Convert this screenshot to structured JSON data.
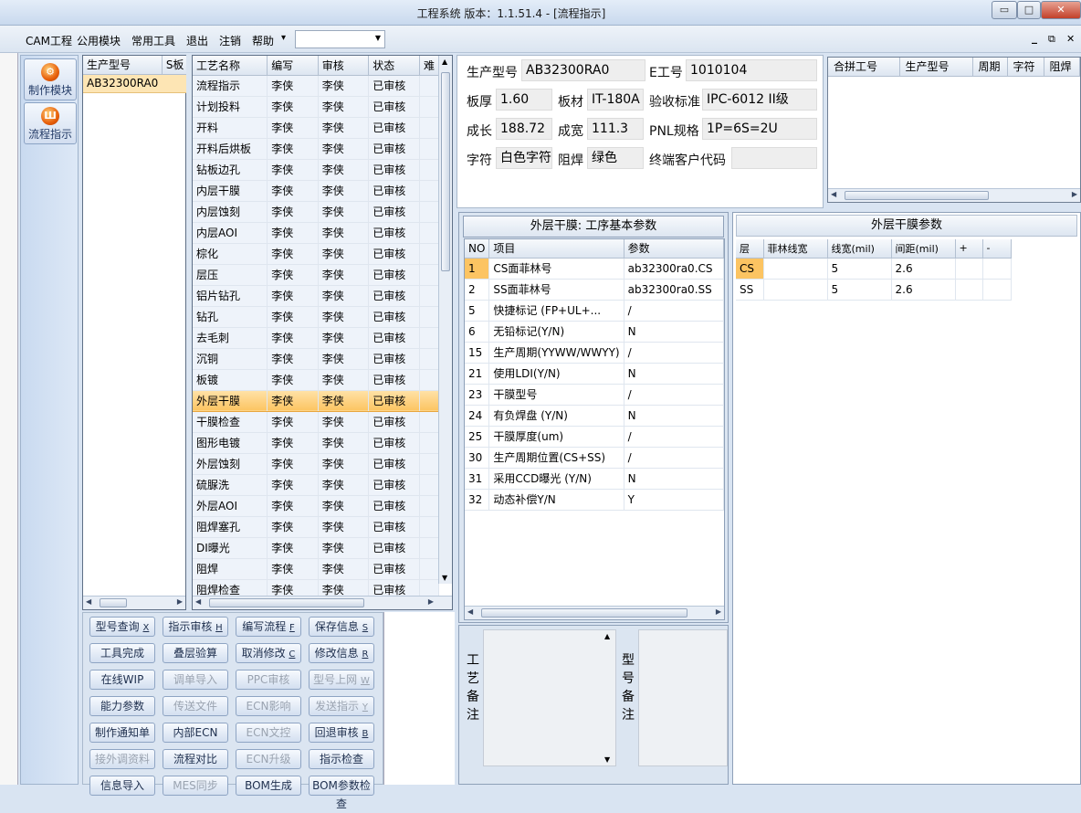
{
  "window": {
    "title": "工程系统   版本：1.1.51.4 - [流程指示]",
    "min_glyph": "▭",
    "max_glyph": "□",
    "close_glyph": "✕"
  },
  "menu": {
    "items": [
      "CAM工程",
      "公用模块",
      "常用工具",
      "退出",
      "注销",
      "帮助"
    ],
    "dropdown_glyph": "▾",
    "combo_value": "",
    "mdi_min": "_",
    "mdi_restore": "⧉",
    "mdi_close": "✕"
  },
  "nav": {
    "items": [
      {
        "label": "制作模块",
        "icon": "gear-icon",
        "glyph": "⚙"
      },
      {
        "label": "流程指示",
        "icon": "flow-icon",
        "glyph": "Ш"
      }
    ]
  },
  "model_list": {
    "headers": [
      "生产型号",
      "S板"
    ],
    "rows": [
      [
        "AB32300RA0",
        ""
      ]
    ]
  },
  "process_table": {
    "headers": [
      "工艺名称",
      "编写",
      "审核",
      "状态",
      "难"
    ],
    "selected_index": 15,
    "rows": [
      [
        "流程指示",
        "李侠",
        "李侠",
        "已审核"
      ],
      [
        "计划投料",
        "李侠",
        "李侠",
        "已审核"
      ],
      [
        "开料",
        "李侠",
        "李侠",
        "已审核"
      ],
      [
        "开料后烘板",
        "李侠",
        "李侠",
        "已审核"
      ],
      [
        "钻板边孔",
        "李侠",
        "李侠",
        "已审核"
      ],
      [
        "内层干膜",
        "李侠",
        "李侠",
        "已审核"
      ],
      [
        "内层蚀刻",
        "李侠",
        "李侠",
        "已审核"
      ],
      [
        "内层AOI",
        "李侠",
        "李侠",
        "已审核"
      ],
      [
        "棕化",
        "李侠",
        "李侠",
        "已审核"
      ],
      [
        "层压",
        "李侠",
        "李侠",
        "已审核"
      ],
      [
        "铝片钻孔",
        "李侠",
        "李侠",
        "已审核"
      ],
      [
        "钻孔",
        "李侠",
        "李侠",
        "已审核"
      ],
      [
        "去毛刺",
        "李侠",
        "李侠",
        "已审核"
      ],
      [
        "沉铜",
        "李侠",
        "李侠",
        "已审核"
      ],
      [
        "板镀",
        "李侠",
        "李侠",
        "已审核"
      ],
      [
        "外层干膜",
        "李侠",
        "李侠",
        "已审核"
      ],
      [
        "干膜检查",
        "李侠",
        "李侠",
        "已审核"
      ],
      [
        "图形电镀",
        "李侠",
        "李侠",
        "已审核"
      ],
      [
        "外层蚀刻",
        "李侠",
        "李侠",
        "已审核"
      ],
      [
        "硫脲洗",
        "李侠",
        "李侠",
        "已审核"
      ],
      [
        "外层AOI",
        "李侠",
        "李侠",
        "已审核"
      ],
      [
        "阻焊塞孔",
        "李侠",
        "李侠",
        "已审核"
      ],
      [
        "DI曝光",
        "李侠",
        "李侠",
        "已审核"
      ],
      [
        "阻焊",
        "李侠",
        "李侠",
        "已审核"
      ],
      [
        "阻焊检查",
        "李侠",
        "李侠",
        "已审核"
      ]
    ]
  },
  "actions": [
    {
      "label": "型号查询",
      "key": "X",
      "enabled": true
    },
    {
      "label": "指示审核",
      "key": "H",
      "enabled": true
    },
    {
      "label": "编写流程",
      "key": "F",
      "enabled": true
    },
    {
      "label": "保存信息",
      "key": "S",
      "enabled": true
    },
    {
      "label": "工具完成",
      "key": "",
      "enabled": true
    },
    {
      "label": "叠层验算",
      "key": "",
      "enabled": true
    },
    {
      "label": "取消修改",
      "key": "C",
      "enabled": true
    },
    {
      "label": "修改信息",
      "key": "R",
      "enabled": true
    },
    {
      "label": "在线WIP",
      "key": "",
      "enabled": true
    },
    {
      "label": "调单导入",
      "key": "",
      "enabled": false
    },
    {
      "label": "PPC审核",
      "key": "",
      "enabled": false
    },
    {
      "label": "型号上网",
      "key": "W",
      "enabled": false
    },
    {
      "label": "能力参数",
      "key": "",
      "enabled": true
    },
    {
      "label": "传送文件",
      "key": "",
      "enabled": false
    },
    {
      "label": "ECN影响",
      "key": "",
      "enabled": false
    },
    {
      "label": "发送指示",
      "key": "Y",
      "enabled": false
    },
    {
      "label": "制作通知单",
      "key": "",
      "enabled": true
    },
    {
      "label": "内部ECN",
      "key": "",
      "enabled": true
    },
    {
      "label": "ECN文控",
      "key": "",
      "enabled": false
    },
    {
      "label": "回退审核",
      "key": "B",
      "enabled": true
    },
    {
      "label": "接外调资料",
      "key": "",
      "enabled": false
    },
    {
      "label": "流程对比",
      "key": "",
      "enabled": true
    },
    {
      "label": "ECN升级",
      "key": "",
      "enabled": false
    },
    {
      "label": "指示检查",
      "key": "",
      "enabled": true
    },
    {
      "label": "信息导入",
      "key": "",
      "enabled": true
    },
    {
      "label": "MES同步",
      "key": "",
      "enabled": false
    },
    {
      "label": "BOM生成",
      "key": "",
      "enabled": true
    },
    {
      "label": "BOM参数检查",
      "key": "",
      "enabled": true
    }
  ],
  "info": {
    "model_label": "生产型号",
    "model": "AB32300RA0",
    "eno_label": "E工号",
    "eno": "1010104",
    "thick_label": "板厚",
    "thick": "1.60",
    "material_label": "板材",
    "material": "IT-180A",
    "std_label": "验收标准",
    "std": "IPC-6012 II级",
    "length_label": "成长",
    "length": "188.72",
    "width_label": "成宽",
    "width": "111.3",
    "pnl_label": "PNL规格",
    "pnl": "1P=6S=2U",
    "char_label": "字符",
    "char": "白色字符",
    "mask_label": "阻焊",
    "mask": "绿色",
    "cust_label": "终端客户代码",
    "cust": ""
  },
  "merge_table": {
    "headers": [
      "合拼工号",
      "生产型号",
      "周期",
      "字符",
      "阻焊"
    ]
  },
  "process_params": {
    "title": "外层干膜: 工序基本参数",
    "headers": [
      "NO",
      "项目",
      "参数"
    ],
    "rows": [
      [
        "1",
        "CS面菲林号",
        "ab32300ra0.CS"
      ],
      [
        "2",
        "SS面菲林号",
        "ab32300ra0.SS"
      ],
      [
        "5",
        "快捷标记 (FP+UL+...",
        "/"
      ],
      [
        "6",
        "无铅标记(Y/N)",
        "N"
      ],
      [
        "15",
        "生产周期(YYWW/WWYY)",
        "/"
      ],
      [
        "21",
        "使用LDI(Y/N)",
        "N"
      ],
      [
        "23",
        "干膜型号",
        "/"
      ],
      [
        "24",
        "有负焊盘 (Y/N)",
        "N"
      ],
      [
        "25",
        "干膜厚度(um)",
        "/"
      ],
      [
        "30",
        "生产周期位置(CS+SS)",
        "/"
      ],
      [
        "31",
        "采用CCD曝光 (Y/N)",
        "N"
      ],
      [
        "32",
        "动态补偿Y/N",
        "Y"
      ]
    ]
  },
  "film_params": {
    "title": "外层干膜参数",
    "headers": [
      "层",
      "菲林线宽",
      "线宽(mil)",
      "间距(mil)",
      "+",
      "-"
    ],
    "rows": [
      [
        "CS",
        "",
        "5",
        "2.6",
        "",
        ""
      ],
      [
        "SS",
        "",
        "5",
        "2.6",
        "",
        ""
      ]
    ]
  },
  "remarks": {
    "process_label": "工艺备注",
    "model_label": "型号备注"
  }
}
